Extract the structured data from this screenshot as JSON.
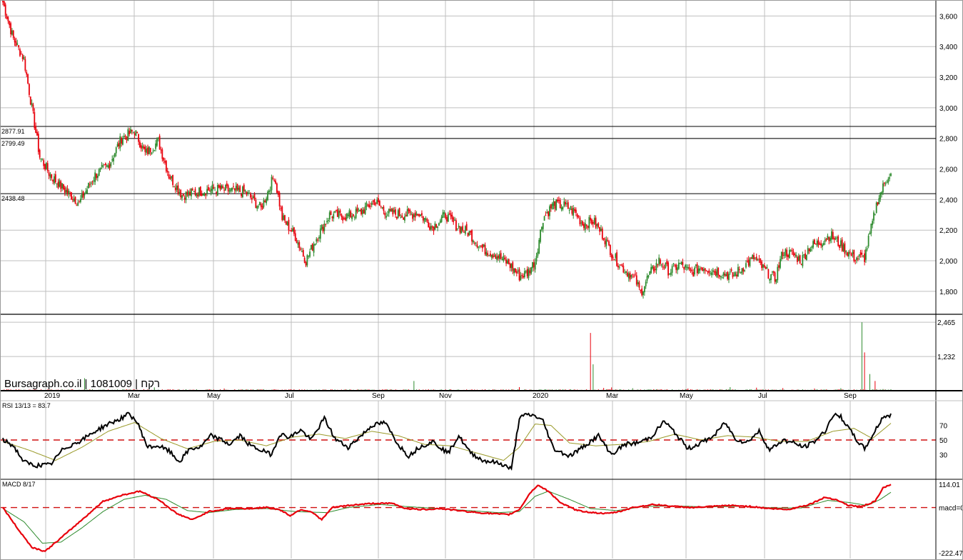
{
  "watermark": "Bursagraph.co.il | 1081009 | רקח",
  "colors": {
    "up": "#2e8b2e",
    "down": "#e8000b",
    "grid": "#bfbfbf",
    "frame": "#000000",
    "rsi_line": "#000000",
    "rsi_signal": "#9a9a2a",
    "macd_line": "#e8000b",
    "macd_signal": "#2e8b2e",
    "dashed": "#d01010"
  },
  "chart_data": [
    {
      "panel": "price",
      "type": "candlestick",
      "x_labels": [
        "2019",
        "Mar",
        "May",
        "Jul",
        "Sep",
        "Nov",
        "2020",
        "Mar",
        "May",
        "Jul",
        "Sep"
      ],
      "y_ticks": [
        "3,600",
        "3,400",
        "3,200",
        "3,000",
        "2,800",
        "2,600",
        "2,400",
        "2,200",
        "2,000",
        "1,800"
      ],
      "ylim": [
        1650,
        3700
      ],
      "horizontal_levels": [
        {
          "label": "2877.91",
          "value": 2877.91
        },
        {
          "label": "2799.49",
          "value": 2799.49
        },
        {
          "label": "2438.48",
          "value": 2438.48
        }
      ],
      "close_anchors": [
        [
          0,
          3690
        ],
        [
          8,
          3450
        ],
        [
          16,
          3320
        ],
        [
          22,
          3000
        ],
        [
          28,
          2680
        ],
        [
          36,
          2560
        ],
        [
          46,
          2470
        ],
        [
          58,
          2380
        ],
        [
          70,
          2560
        ],
        [
          80,
          2620
        ],
        [
          90,
          2800
        ],
        [
          100,
          2850
        ],
        [
          108,
          2700
        ],
        [
          118,
          2780
        ],
        [
          126,
          2560
        ],
        [
          136,
          2430
        ],
        [
          148,
          2450
        ],
        [
          160,
          2470
        ],
        [
          172,
          2460
        ],
        [
          184,
          2450
        ],
        [
          196,
          2340
        ],
        [
          206,
          2560
        ],
        [
          212,
          2280
        ],
        [
          222,
          2160
        ],
        [
          230,
          2000
        ],
        [
          238,
          2150
        ],
        [
          248,
          2300
        ],
        [
          260,
          2290
        ],
        [
          272,
          2320
        ],
        [
          282,
          2390
        ],
        [
          292,
          2310
        ],
        [
          304,
          2300
        ],
        [
          316,
          2310
        ],
        [
          326,
          2220
        ],
        [
          336,
          2300
        ],
        [
          344,
          2230
        ],
        [
          354,
          2180
        ],
        [
          364,
          2080
        ],
        [
          374,
          2040
        ],
        [
          384,
          1980
        ],
        [
          392,
          1900
        ],
        [
          398,
          1920
        ],
        [
          404,
          2000
        ],
        [
          410,
          2280
        ],
        [
          418,
          2370
        ],
        [
          426,
          2360
        ],
        [
          434,
          2320
        ],
        [
          440,
          2240
        ],
        [
          448,
          2260
        ],
        [
          456,
          2160
        ],
        [
          464,
          2020
        ],
        [
          472,
          1940
        ],
        [
          480,
          1880
        ],
        [
          484,
          1790
        ],
        [
          490,
          1900
        ],
        [
          498,
          2000
        ],
        [
          506,
          1930
        ],
        [
          514,
          1980
        ],
        [
          522,
          1920
        ],
        [
          530,
          1960
        ],
        [
          538,
          1940
        ],
        [
          546,
          1920
        ],
        [
          554,
          1900
        ],
        [
          562,
          1960
        ],
        [
          570,
          2020
        ],
        [
          578,
          1940
        ],
        [
          586,
          1880
        ],
        [
          592,
          2060
        ],
        [
          600,
          2040
        ],
        [
          606,
          2000
        ],
        [
          612,
          2090
        ],
        [
          620,
          2120
        ],
        [
          628,
          2170
        ],
        [
          636,
          2100
        ],
        [
          646,
          2020
        ],
        [
          654,
          2020
        ],
        [
          664,
          2400
        ],
        [
          672,
          2560
        ]
      ]
    },
    {
      "panel": "volume",
      "type": "bar",
      "y_ticks": [
        "2,465",
        "1,232"
      ],
      "ylim": [
        0,
        2700
      ],
      "spikes": [
        [
          62,
          450
        ],
        [
          115,
          120
        ],
        [
          168,
          80
        ],
        [
          312,
          350
        ],
        [
          392,
          130
        ],
        [
          446,
          2080
        ],
        [
          448,
          950
        ],
        [
          456,
          100
        ],
        [
          462,
          120
        ],
        [
          478,
          90
        ],
        [
          520,
          80
        ],
        [
          552,
          130
        ],
        [
          572,
          110
        ],
        [
          592,
          95
        ],
        [
          616,
          80
        ],
        [
          636,
          90
        ],
        [
          652,
          2465
        ],
        [
          654,
          1380
        ],
        [
          658,
          600
        ],
        [
          662,
          350
        ],
        [
          668,
          60
        ]
      ]
    },
    {
      "panel": "rsi",
      "type": "line",
      "title": "RSI 13/13 = 83.7",
      "y_ticks": [
        "70",
        "50",
        "30"
      ],
      "ylim": [
        0,
        100
      ],
      "reference_level": 50,
      "anchors": [
        [
          0,
          50
        ],
        [
          8,
          42
        ],
        [
          16,
          20
        ],
        [
          24,
          15
        ],
        [
          36,
          16
        ],
        [
          46,
          38
        ],
        [
          60,
          50
        ],
        [
          70,
          62
        ],
        [
          80,
          72
        ],
        [
          88,
          78
        ],
        [
          96,
          86
        ],
        [
          102,
          74
        ],
        [
          110,
          40
        ],
        [
          118,
          42
        ],
        [
          126,
          35
        ],
        [
          134,
          20
        ],
        [
          142,
          38
        ],
        [
          150,
          40
        ],
        [
          158,
          56
        ],
        [
          166,
          50
        ],
        [
          172,
          44
        ],
        [
          180,
          56
        ],
        [
          188,
          42
        ],
        [
          196,
          36
        ],
        [
          204,
          30
        ],
        [
          210,
          58
        ],
        [
          218,
          54
        ],
        [
          226,
          64
        ],
        [
          234,
          50
        ],
        [
          244,
          80
        ],
        [
          252,
          52
        ],
        [
          262,
          40
        ],
        [
          272,
          56
        ],
        [
          280,
          70
        ],
        [
          290,
          74
        ],
        [
          300,
          44
        ],
        [
          308,
          28
        ],
        [
          316,
          40
        ],
        [
          326,
          48
        ],
        [
          338,
          32
        ],
        [
          346,
          56
        ],
        [
          354,
          34
        ],
        [
          364,
          22
        ],
        [
          372,
          20
        ],
        [
          380,
          16
        ],
        [
          386,
          10
        ],
        [
          392,
          80
        ],
        [
          398,
          85
        ],
        [
          404,
          83
        ],
        [
          410,
          76
        ],
        [
          418,
          38
        ],
        [
          430,
          28
        ],
        [
          440,
          40
        ],
        [
          452,
          56
        ],
        [
          462,
          30
        ],
        [
          472,
          44
        ],
        [
          482,
          46
        ],
        [
          492,
          54
        ],
        [
          502,
          76
        ],
        [
          510,
          60
        ],
        [
          520,
          38
        ],
        [
          530,
          46
        ],
        [
          540,
          56
        ],
        [
          548,
          74
        ],
        [
          556,
          52
        ],
        [
          564,
          46
        ],
        [
          574,
          62
        ],
        [
          582,
          36
        ],
        [
          592,
          50
        ],
        [
          600,
          46
        ],
        [
          608,
          40
        ],
        [
          616,
          48
        ],
        [
          624,
          62
        ],
        [
          630,
          84
        ],
        [
          636,
          82
        ],
        [
          642,
          66
        ],
        [
          648,
          50
        ],
        [
          654,
          38
        ],
        [
          660,
          56
        ],
        [
          668,
          82
        ],
        [
          674,
          84
        ]
      ],
      "signal_anchors": [
        [
          0,
          48
        ],
        [
          20,
          36
        ],
        [
          40,
          22
        ],
        [
          60,
          40
        ],
        [
          80,
          62
        ],
        [
          100,
          74
        ],
        [
          120,
          52
        ],
        [
          140,
          38
        ],
        [
          160,
          48
        ],
        [
          180,
          50
        ],
        [
          200,
          42
        ],
        [
          220,
          54
        ],
        [
          240,
          58
        ],
        [
          260,
          52
        ],
        [
          280,
          62
        ],
        [
          300,
          56
        ],
        [
          320,
          44
        ],
        [
          340,
          42
        ],
        [
          360,
          32
        ],
        [
          380,
          22
        ],
        [
          392,
          40
        ],
        [
          404,
          72
        ],
        [
          416,
          70
        ],
        [
          430,
          46
        ],
        [
          450,
          42
        ],
        [
          470,
          44
        ],
        [
          490,
          48
        ],
        [
          510,
          58
        ],
        [
          530,
          50
        ],
        [
          550,
          56
        ],
        [
          570,
          54
        ],
        [
          590,
          48
        ],
        [
          610,
          48
        ],
        [
          630,
          62
        ],
        [
          646,
          66
        ],
        [
          660,
          52
        ],
        [
          674,
          73
        ]
      ]
    },
    {
      "panel": "macd",
      "type": "line",
      "title": "MACD 8/17",
      "y_ticks": [
        "114.01",
        "macd=0",
        "-222.47"
      ],
      "ylim": [
        -222.47,
        114.01
      ],
      "reference_level": 0,
      "anchors": [
        [
          0,
          0
        ],
        [
          12,
          -110
        ],
        [
          22,
          -195
        ],
        [
          32,
          -215
        ],
        [
          44,
          -150
        ],
        [
          60,
          -60
        ],
        [
          76,
          30
        ],
        [
          90,
          60
        ],
        [
          104,
          80
        ],
        [
          118,
          40
        ],
        [
          132,
          -30
        ],
        [
          144,
          -60
        ],
        [
          156,
          -20
        ],
        [
          172,
          -5
        ],
        [
          188,
          -5
        ],
        [
          200,
          0
        ],
        [
          210,
          -10
        ],
        [
          218,
          -40
        ],
        [
          226,
          -10
        ],
        [
          234,
          -20
        ],
        [
          242,
          -60
        ],
        [
          250,
          0
        ],
        [
          262,
          10
        ],
        [
          280,
          20
        ],
        [
          296,
          20
        ],
        [
          306,
          -5
        ],
        [
          318,
          -10
        ],
        [
          332,
          -5
        ],
        [
          346,
          -15
        ],
        [
          360,
          -25
        ],
        [
          372,
          -30
        ],
        [
          384,
          -35
        ],
        [
          392,
          -10
        ],
        [
          400,
          70
        ],
        [
          406,
          110
        ],
        [
          414,
          80
        ],
        [
          424,
          20
        ],
        [
          436,
          -15
        ],
        [
          448,
          -25
        ],
        [
          458,
          -30
        ],
        [
          468,
          -20
        ],
        [
          478,
          0
        ],
        [
          494,
          15
        ],
        [
          510,
          5
        ],
        [
          524,
          0
        ],
        [
          538,
          5
        ],
        [
          552,
          10
        ],
        [
          568,
          5
        ],
        [
          582,
          -5
        ],
        [
          596,
          -10
        ],
        [
          612,
          15
        ],
        [
          624,
          50
        ],
        [
          632,
          40
        ],
        [
          642,
          10
        ],
        [
          652,
          5
        ],
        [
          662,
          30
        ],
        [
          668,
          95
        ],
        [
          674,
          114
        ]
      ],
      "signal_anchors": [
        [
          0,
          -5
        ],
        [
          16,
          -70
        ],
        [
          30,
          -175
        ],
        [
          44,
          -170
        ],
        [
          60,
          -100
        ],
        [
          76,
          -20
        ],
        [
          92,
          40
        ],
        [
          108,
          60
        ],
        [
          124,
          40
        ],
        [
          140,
          -15
        ],
        [
          156,
          -25
        ],
        [
          176,
          -10
        ],
        [
          200,
          -5
        ],
        [
          222,
          -20
        ],
        [
          246,
          -25
        ],
        [
          262,
          0
        ],
        [
          286,
          15
        ],
        [
          306,
          5
        ],
        [
          330,
          -5
        ],
        [
          354,
          -15
        ],
        [
          376,
          -25
        ],
        [
          392,
          -20
        ],
        [
          404,
          55
        ],
        [
          414,
          80
        ],
        [
          430,
          40
        ],
        [
          446,
          -5
        ],
        [
          466,
          -15
        ],
        [
          486,
          5
        ],
        [
          510,
          8
        ],
        [
          534,
          3
        ],
        [
          560,
          6
        ],
        [
          586,
          -2
        ],
        [
          606,
          -2
        ],
        [
          626,
          35
        ],
        [
          642,
          25
        ],
        [
          656,
          10
        ],
        [
          666,
          40
        ],
        [
          674,
          75
        ]
      ]
    }
  ]
}
